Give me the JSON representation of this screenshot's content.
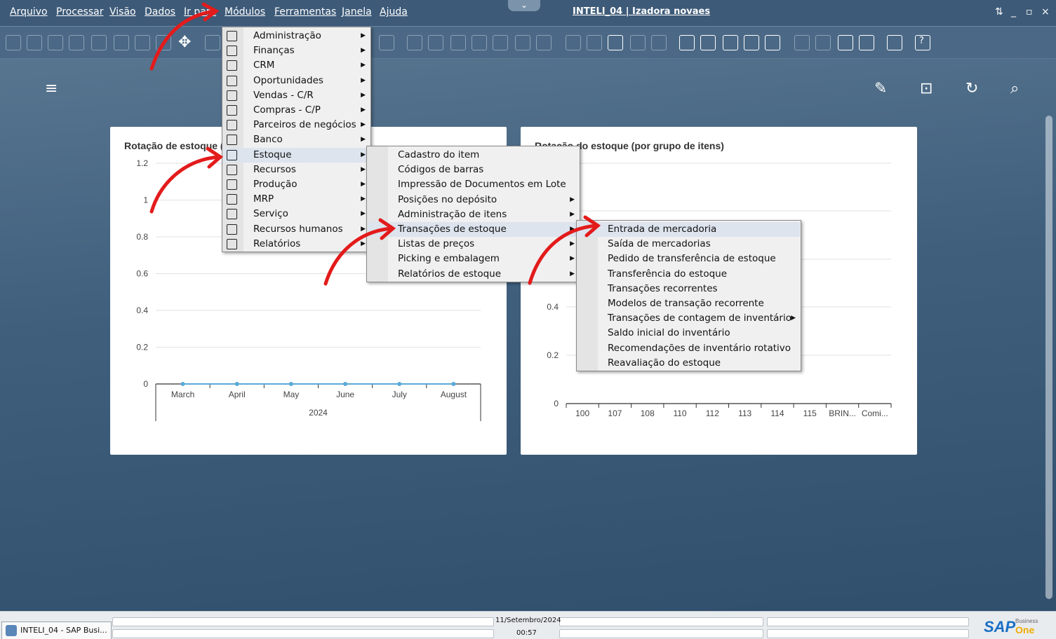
{
  "menubar": {
    "items": [
      "Arquivo",
      "Processar",
      "Visão",
      "Dados",
      "Ir para",
      "Módulos",
      "Ferramentas",
      "Janela",
      "Ajuda"
    ],
    "session": "INTELI_04 | Izadora novaes",
    "window_controls": [
      "⇅",
      "_",
      "▫",
      "×"
    ]
  },
  "header_icons": {
    "menu": "≡",
    "edit": "✎",
    "layout": "⊡",
    "refresh": "↻",
    "search": "⌕"
  },
  "cards": {
    "left": {
      "title": "Rotação de estoque (comparativo de 6 meses)"
    },
    "right": {
      "title": "Rotação do estoque (por grupo de itens)"
    }
  },
  "chart_data": [
    {
      "type": "line",
      "title": "Rotação de estoque (comparativo de 6 meses)",
      "categories": [
        "March",
        "April",
        "May",
        "June",
        "July",
        "August"
      ],
      "x_group_label": "2024",
      "values": [
        0,
        0,
        0,
        0,
        0,
        0
      ],
      "ylim": [
        0,
        1.2
      ],
      "yticks": [
        "0",
        "0.2",
        "0.4",
        "0.6",
        "0.8",
        "1",
        "1.2"
      ],
      "grid": true,
      "color": "#5aaad6"
    },
    {
      "type": "bar",
      "title": "Rotação do estoque (por grupo de itens)",
      "categories": [
        "100",
        "107",
        "108",
        "110",
        "112",
        "113",
        "114",
        "115",
        "BRIN...",
        "Comi..."
      ],
      "values": [
        0,
        0,
        0,
        0,
        0,
        0,
        0,
        0,
        0,
        0
      ],
      "yticks": [
        "0",
        "0.2",
        "0.4"
      ],
      "grid": true
    }
  ],
  "menus": {
    "modulos": [
      {
        "label": "Administração",
        "u": "A",
        "icon": "gear-icon",
        "sub": true
      },
      {
        "label": "Finanças",
        "u": "F",
        "icon": "finance-icon",
        "sub": true
      },
      {
        "label": "CRM",
        "u": "C",
        "icon": "crm-icon",
        "sub": true
      },
      {
        "label": "Oportunidades",
        "u": "O",
        "icon": "opportunity-icon",
        "sub": true
      },
      {
        "label": "Vendas - C/R",
        "u": "V",
        "icon": "sales-icon",
        "sub": true
      },
      {
        "label": "Compras - C/P",
        "u": "",
        "icon": "cart-icon",
        "sub": true
      },
      {
        "label": "Parceiros de negócios",
        "u": "P",
        "icon": "partners-icon",
        "sub": true
      },
      {
        "label": "Banco",
        "u": "B",
        "icon": "bank-icon",
        "sub": true
      },
      {
        "label": "Estoque",
        "u": "E",
        "icon": "inventory-icon",
        "sub": true,
        "hl": true
      },
      {
        "label": "Recursos",
        "u": "R",
        "icon": "resources-icon",
        "sub": true
      },
      {
        "label": "Produção",
        "u": "",
        "icon": "production-icon",
        "sub": true
      },
      {
        "label": "MRP",
        "u": "",
        "icon": "mrp-icon",
        "sub": true
      },
      {
        "label": "Serviço",
        "u": "S",
        "icon": "service-icon",
        "sub": true
      },
      {
        "label": "Recursos humanos",
        "u": "",
        "icon": "hr-icon",
        "sub": true
      },
      {
        "label": "Relatórios",
        "u": "",
        "icon": "reports-icon",
        "sub": true
      }
    ],
    "estoque": [
      {
        "label": "Cadastro do item",
        "sub": false
      },
      {
        "label": "Códigos de barras",
        "sub": false
      },
      {
        "label": "Impressão de Documentos em Lote",
        "sub": false
      },
      {
        "label": "Posições no depósito",
        "sub": true
      },
      {
        "label": "Administração de itens",
        "sub": true
      },
      {
        "label": "Transações de estoque",
        "sub": true,
        "hl": true
      },
      {
        "label": "Listas de preços",
        "sub": true
      },
      {
        "label": "Picking e embalagem",
        "sub": true
      },
      {
        "label": "Relatórios de estoque",
        "sub": true
      }
    ],
    "transacoes": [
      {
        "label": "Entrada de mercadoria",
        "sub": false,
        "hl": true
      },
      {
        "label": "Saída de mercadorias",
        "sub": false
      },
      {
        "label": "Pedido de transferência de estoque",
        "sub": false
      },
      {
        "label": "Transferência do estoque",
        "sub": false
      },
      {
        "label": "Transações recorrentes",
        "sub": false
      },
      {
        "label": "Modelos de transação recorrente",
        "sub": false
      },
      {
        "label": "Transações de contagem de inventário",
        "sub": true
      },
      {
        "label": "Saldo inicial do inventário",
        "sub": false
      },
      {
        "label": "Recomendações de inventário rotativo",
        "sub": false
      },
      {
        "label": "Reavaliação do estoque",
        "sub": false
      }
    ]
  },
  "statusbar": {
    "date": "11/Setembro/2024",
    "time": "00:57",
    "task": "INTELI_04 - SAP Busi...",
    "brand": "SAP",
    "brand_sub": "Business",
    "brand_one": "One"
  },
  "colors": {
    "annotation_arrow": "#e31b1b",
    "chart_line": "#5aaad6",
    "menu_highlight": "#dde4ee"
  }
}
